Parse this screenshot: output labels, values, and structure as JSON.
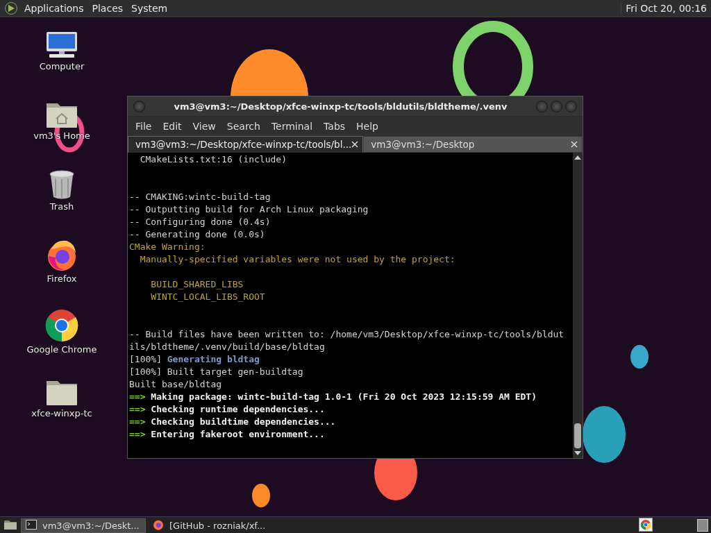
{
  "top_panel": {
    "menus": [
      "Applications",
      "Places",
      "System"
    ],
    "clock": "Fri Oct 20, 00:16"
  },
  "desktop_icons": [
    {
      "kind": "computer",
      "label": "Computer"
    },
    {
      "kind": "home",
      "label": "vm3's Home"
    },
    {
      "kind": "trash",
      "label": "Trash"
    },
    {
      "kind": "firefox",
      "label": "Firefox"
    },
    {
      "kind": "chrome",
      "label": "Google Chrome"
    },
    {
      "kind": "folder",
      "label": "xfce-winxp-tc"
    }
  ],
  "window": {
    "title": "vm3@vm3:~/Desktop/xfce-winxp-tc/tools/bldutils/bldtheme/.venv",
    "menu": [
      "File",
      "Edit",
      "View",
      "Search",
      "Terminal",
      "Tabs",
      "Help"
    ],
    "tabs": [
      {
        "label": "vm3@vm3:~/Desktop/xfce-winxp-tc/tools/bl...",
        "selected": true
      },
      {
        "label": "vm3@vm3:~/Desktop",
        "selected": false
      }
    ],
    "lines": [
      {
        "kind": "text",
        "segments": [
          {
            "kind": "plain",
            "text": "  CMakeLists.txt:16 (include)"
          }
        ]
      },
      {
        "kind": "blank"
      },
      {
        "kind": "blank"
      },
      {
        "kind": "text",
        "segments": [
          {
            "kind": "plain",
            "text": "-- CMAKING:wintc-build-tag"
          }
        ]
      },
      {
        "kind": "text",
        "segments": [
          {
            "kind": "plain",
            "text": "-- Outputting build for Arch Linux packaging"
          }
        ]
      },
      {
        "kind": "text",
        "segments": [
          {
            "kind": "plain",
            "text": "-- Configuring done (0.4s)"
          }
        ]
      },
      {
        "kind": "text",
        "segments": [
          {
            "kind": "plain",
            "text": "-- Generating done (0.0s)"
          }
        ]
      },
      {
        "kind": "text",
        "segments": [
          {
            "kind": "warn",
            "text": "CMake Warning:"
          }
        ]
      },
      {
        "kind": "text",
        "segments": [
          {
            "kind": "warn",
            "text": "  Manually-specified variables were not used by the project:"
          }
        ]
      },
      {
        "kind": "blank"
      },
      {
        "kind": "text",
        "segments": [
          {
            "kind": "warn",
            "text": "    BUILD_SHARED_LIBS"
          }
        ]
      },
      {
        "kind": "text",
        "segments": [
          {
            "kind": "warn",
            "text": "    WINTC_LOCAL_LIBS_ROOT"
          }
        ]
      },
      {
        "kind": "blank"
      },
      {
        "kind": "blank"
      },
      {
        "kind": "text",
        "segments": [
          {
            "kind": "plain",
            "text": "-- Build files have been written to: /home/vm3/Desktop/xfce-winxp-tc/tools/bldut"
          }
        ]
      },
      {
        "kind": "text",
        "segments": [
          {
            "kind": "plain",
            "text": "ils/bldtheme/.venv/build/base/bldtag"
          }
        ]
      },
      {
        "kind": "text",
        "segments": [
          {
            "kind": "plain",
            "text": "[100%] "
          },
          {
            "kind": "blue",
            "text": "Generating bldtag"
          }
        ]
      },
      {
        "kind": "text",
        "segments": [
          {
            "kind": "plain",
            "text": "[100%] Built target gen-buildtag"
          }
        ]
      },
      {
        "kind": "text",
        "segments": [
          {
            "kind": "plain",
            "text": "Built base/bldtag"
          }
        ]
      },
      {
        "kind": "text",
        "segments": [
          {
            "kind": "arrow",
            "text": "==> "
          },
          {
            "kind": "bold",
            "text": "Making package: wintc-build-tag 1.0-1 (Fri 20 Oct 2023 12:15:59 AM EDT)"
          }
        ]
      },
      {
        "kind": "text",
        "segments": [
          {
            "kind": "arrow",
            "text": "==> "
          },
          {
            "kind": "bold",
            "text": "Checking runtime dependencies..."
          }
        ]
      },
      {
        "kind": "text",
        "segments": [
          {
            "kind": "arrow",
            "text": "==> "
          },
          {
            "kind": "bold",
            "text": "Checking buildtime dependencies..."
          }
        ]
      },
      {
        "kind": "text",
        "segments": [
          {
            "kind": "arrow",
            "text": "==> "
          },
          {
            "kind": "bold",
            "text": "Entering fakeroot environment..."
          }
        ]
      }
    ]
  },
  "taskbar": {
    "items": [
      {
        "kind": "terminal",
        "label": "vm3@vm3:~/Deskt...",
        "selected": true
      },
      {
        "kind": "firefox",
        "label": "[GitHub - rozniak/xf...",
        "selected": false
      }
    ]
  }
}
